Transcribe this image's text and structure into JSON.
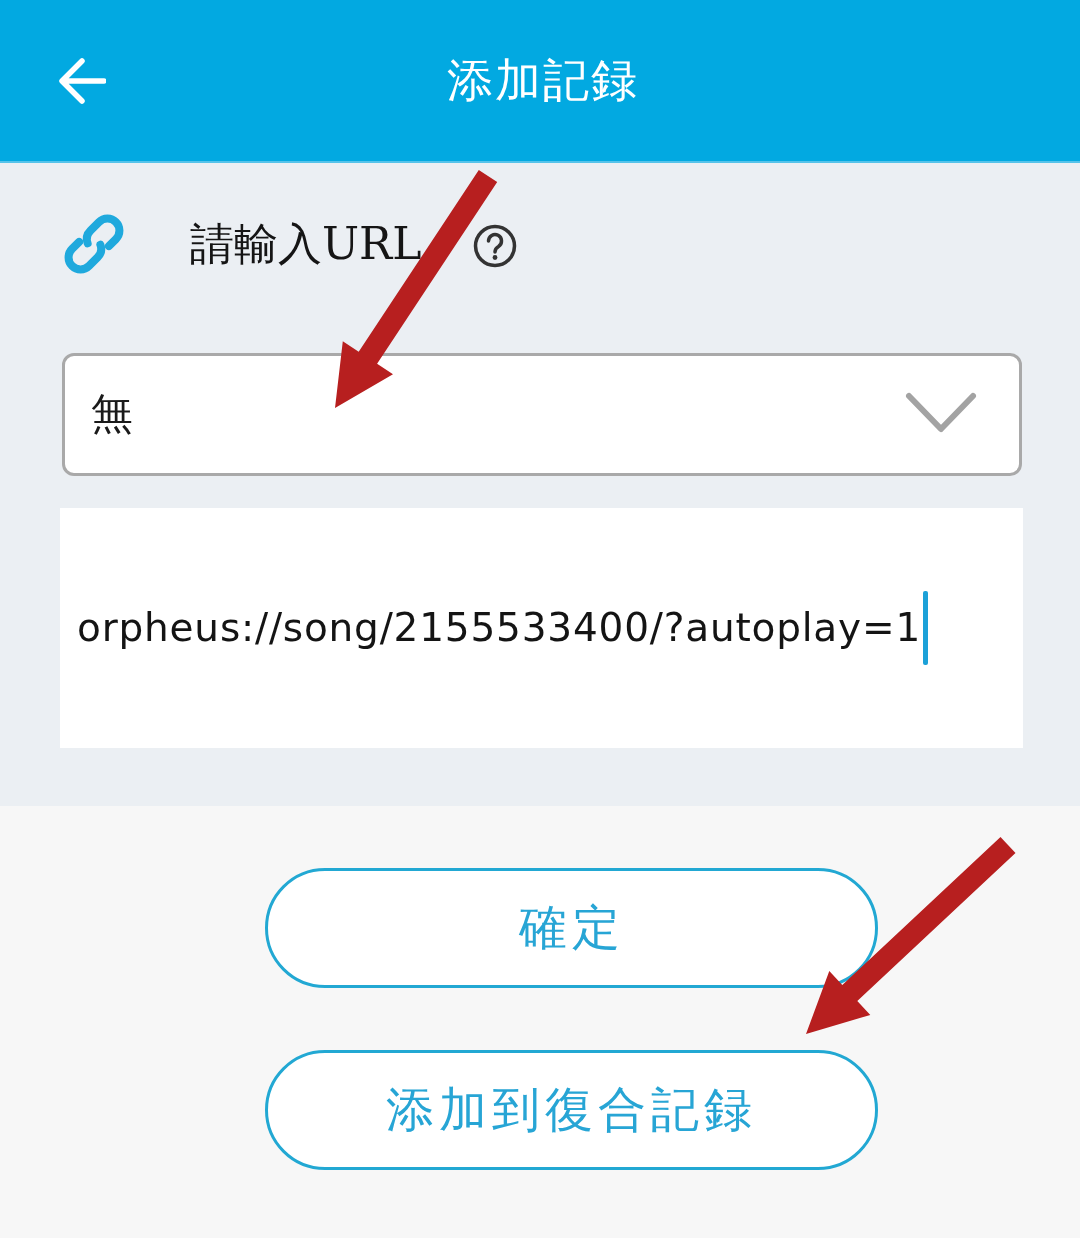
{
  "header": {
    "title": "添加記録"
  },
  "url_section": {
    "label": "請輸入URL"
  },
  "dropdown": {
    "value": "無"
  },
  "url_input": {
    "value": "orpheus://song/2155533400/?autoplay=1",
    "focused": true
  },
  "buttons": [
    {
      "label": "確定"
    },
    {
      "label": "添加到復合記録"
    }
  ]
}
